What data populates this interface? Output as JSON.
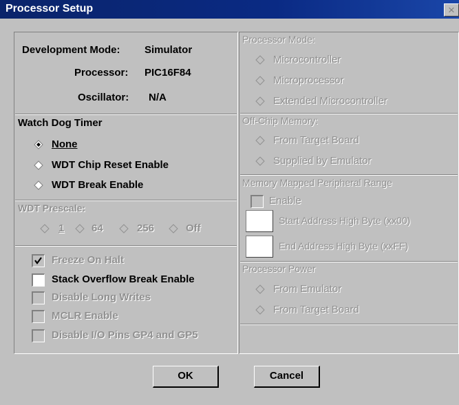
{
  "window": {
    "title": "Processor Setup",
    "close_glyph": "×"
  },
  "info": {
    "dev_mode_label": "Development Mode:",
    "dev_mode_value": "Simulator",
    "processor_label": "Processor:",
    "processor_value": "PIC16F84",
    "oscillator_label": "Oscillator:",
    "oscillator_value": "N/A"
  },
  "watchdog": {
    "title": "Watch Dog Timer",
    "options": [
      {
        "label": "None",
        "selected": true,
        "enabled": true
      },
      {
        "label": "WDT Chip Reset Enable",
        "selected": false,
        "enabled": true
      },
      {
        "label": "WDT Break Enable",
        "selected": false,
        "enabled": true
      }
    ]
  },
  "prescale": {
    "title": "WDT Prescale:",
    "options": [
      "1",
      "64",
      "256",
      "Off"
    ]
  },
  "checkboxes": [
    {
      "label": "Freeze On Halt",
      "checked": true,
      "enabled": false
    },
    {
      "label": "Stack Overflow Break Enable",
      "checked": false,
      "enabled": true
    },
    {
      "label": "Disable Long Writes",
      "checked": false,
      "enabled": false
    },
    {
      "label": "MCLR Enable",
      "checked": false,
      "enabled": false
    },
    {
      "label": "Disable I/O Pins GP4 and GP5",
      "checked": false,
      "enabled": false
    }
  ],
  "processor_mode": {
    "title": "Processor Mode:",
    "options": [
      "Microcontroller",
      "Microprocessor",
      "Extended Microcontroller"
    ]
  },
  "offchip": {
    "title": "Off-Chip Memory:",
    "options": [
      "From Target Board",
      "Supplied by Emulator"
    ]
  },
  "mmpr": {
    "title": "Memory Mapped Peripheral Range",
    "enable_label": "Enable",
    "start_label": "Start Address High Byte (xx00)",
    "end_label": "End Address High Byte (xxFF)",
    "start_value": "",
    "end_value": ""
  },
  "power": {
    "title": "Processor Power",
    "options": [
      "From Emulator",
      "From Target Board"
    ]
  },
  "buttons": {
    "ok": "OK",
    "cancel": "Cancel"
  },
  "colors": {
    "titlebar": "#0a246a",
    "face": "#c0c0c0",
    "disabled_text": "#909090"
  }
}
